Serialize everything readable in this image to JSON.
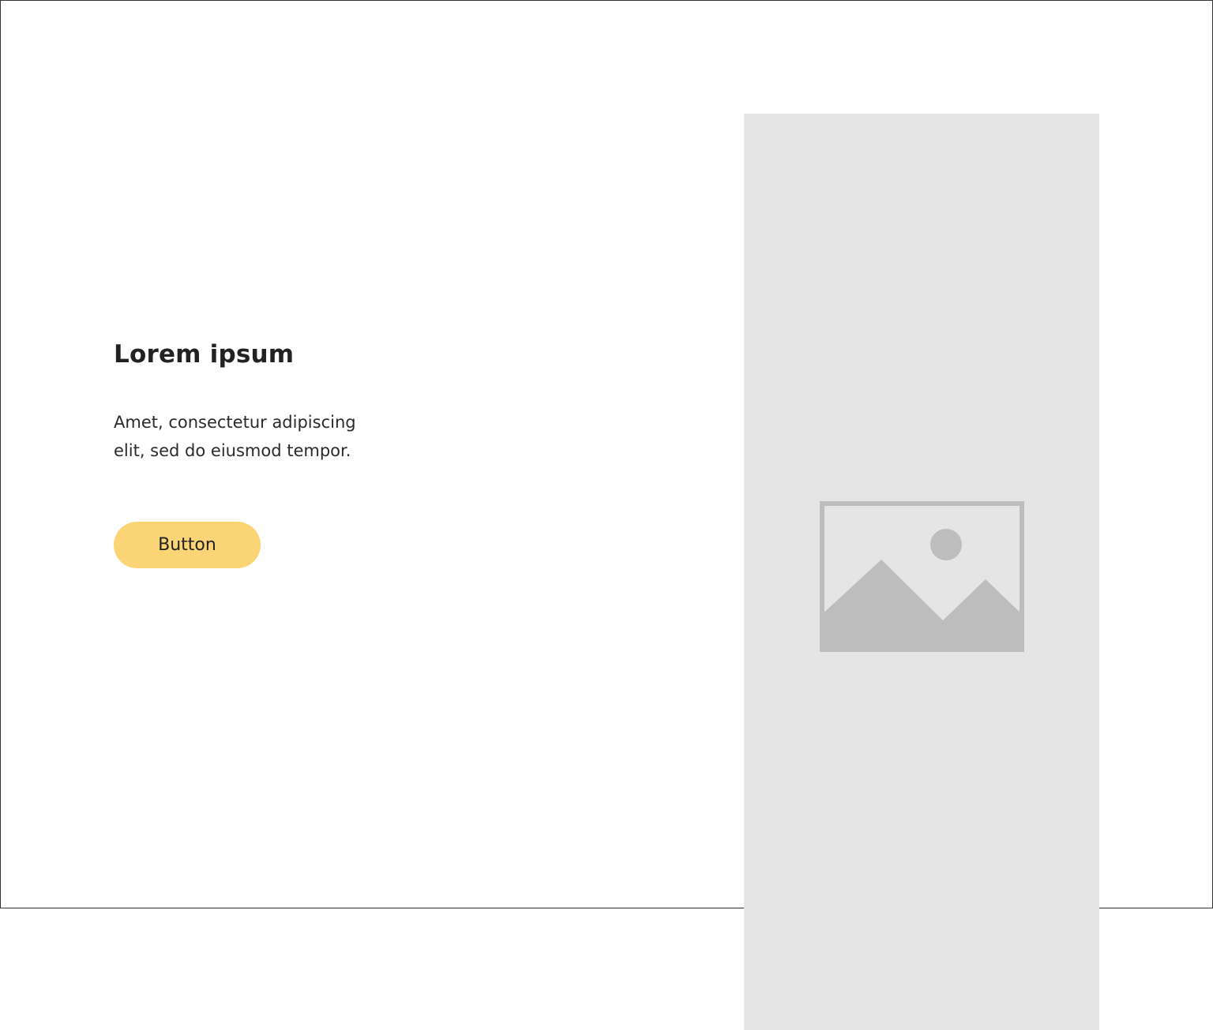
{
  "hero": {
    "title": "Lorem ipsum",
    "description_lines": [
      "Amet, consectetur adipiscing",
      "elit, sed do eiusmod tempor."
    ],
    "button_label": "Button"
  },
  "image_placeholder": {
    "icon": "image-placeholder-icon"
  },
  "colors": {
    "button_background": "#FBD575",
    "panel_background": "#E5E5E5",
    "placeholder_icon": "#BDBDBD",
    "text": "#222222",
    "frame_border": "#333333"
  }
}
